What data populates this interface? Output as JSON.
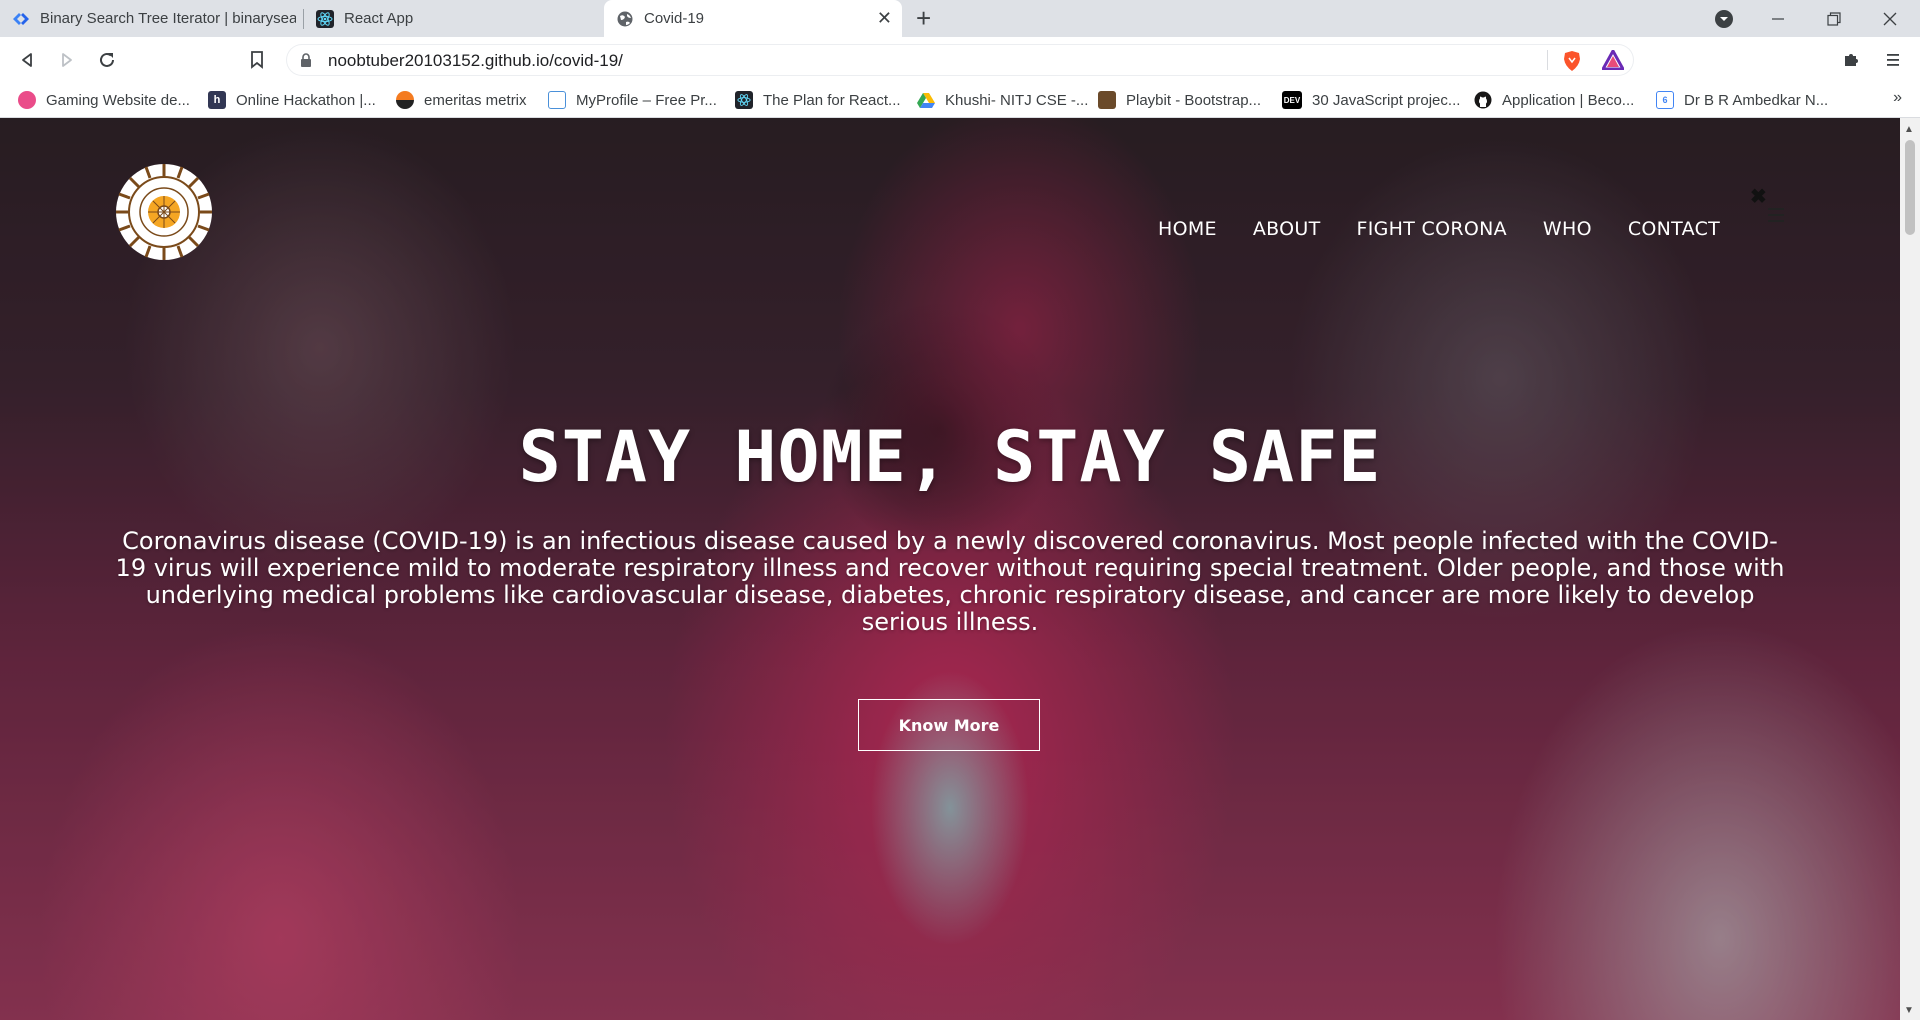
{
  "browser": {
    "tabs": [
      {
        "title": "Binary Search Tree Iterator | binarysear",
        "active": false
      },
      {
        "title": "React App",
        "active": false
      },
      {
        "title": "Covid-19",
        "active": true
      }
    ],
    "url": "noobtuber20103152.github.io/covid-19/",
    "bookmarks": [
      {
        "label": "Gaming Website de...",
        "icon": "dribbble-icon",
        "color": "#ea4c89"
      },
      {
        "label": "Online Hackathon |...",
        "icon": "hackerearth-icon",
        "color": "#323754"
      },
      {
        "label": "emeritas metrix",
        "icon": "orange-circle-icon",
        "color": "#f47b20"
      },
      {
        "label": "MyProfile – Free Pr...",
        "icon": "document-icon",
        "color": "#4a90d9"
      },
      {
        "label": "The Plan for React...",
        "icon": "react-icon",
        "color": "#20232a"
      },
      {
        "label": "Khushi- NITJ CSE -...",
        "icon": "google-drive-icon",
        "color": "#34a853"
      },
      {
        "label": "Playbit - Bootstrap...",
        "icon": "playbit-icon",
        "color": "#6b4a2a"
      },
      {
        "label": "30 JavaScript projec...",
        "icon": "dev-icon",
        "color": "#000000"
      },
      {
        "label": "Application | Beco...",
        "icon": "github-icon",
        "color": "#181717"
      },
      {
        "label": "Dr B R Ambedkar N...",
        "icon": "google-calendar-icon",
        "color": "#4285f4"
      }
    ],
    "bookmarks_more": "»",
    "dev_badge": "DEV"
  },
  "site": {
    "nav": [
      "HOME",
      "ABOUT",
      "FIGHT CORONA",
      "WHO",
      "CONTACT"
    ],
    "hero_title": "STAY HOME, STAY SAFE",
    "hero_text": "Coronavirus disease (COVID-19) is an infectious disease caused by a newly discovered coronavirus. Most people infected with the COVID-19 virus will experience mild to moderate respiratory illness and recover without requiring special treatment. Older people, and those with underlying medical problems like cardiovascular disease, diabetes, chronic respiratory disease, and cancer are more likely to develop serious illness.",
    "cta_label": "Know More",
    "close_glyph": "✖"
  },
  "colors": {
    "brave_orange": "#fb542b",
    "logo_ring": "#7a4a1a",
    "logo_sun": "#f5a623"
  }
}
